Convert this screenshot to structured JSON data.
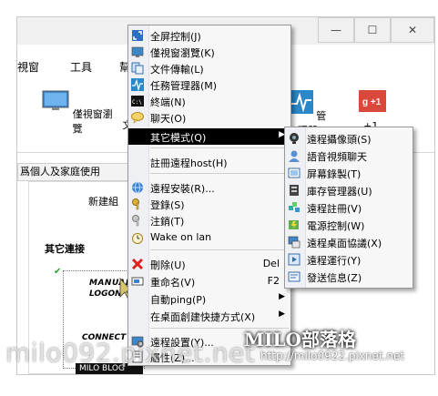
{
  "app": {
    "menu": [
      "視窗",
      "工具",
      "幫"
    ],
    "toolbar": [
      {
        "label": "僅視窗瀏覽",
        "icon": "monitor-icon"
      },
      {
        "label": "文",
        "icon": "none"
      },
      {
        "label": "管理器",
        "icon": "task-manager-icon"
      },
      {
        "label": "+1.",
        "icon": "plus-one-icon"
      }
    ],
    "tab_label": "爲個人及家庭使用",
    "new_group": "新建組",
    "other_connections": "其它連接",
    "thumbnail": {
      "line1": "MANUAL",
      "line2": "LOGON",
      "line3": "CONNECT",
      "caption": "MILO BLOG"
    }
  },
  "context_menu": {
    "items": [
      {
        "label": "全屏控制(J)",
        "icon": "fullscreen-icon"
      },
      {
        "label": "僅視窗瀏覽(K)",
        "icon": "window-view-icon"
      },
      {
        "label": "文件傳輸(L)",
        "icon": "file-transfer-icon"
      },
      {
        "label": "任務管理器(M)",
        "icon": "task-manager-icon"
      },
      {
        "label": "終端(N)",
        "icon": "terminal-icon"
      },
      {
        "label": "聊天(O)",
        "icon": "chat-icon"
      },
      {
        "label": "其它模式(Q)",
        "icon": "none",
        "submenu": true,
        "highlighted": true
      },
      {
        "label": "註冊遠程host(H)",
        "icon": "none"
      },
      {
        "label": "遠程安裝(R)...",
        "icon": "remote-install-icon"
      },
      {
        "label": "登錄(S)",
        "icon": "login-key-icon"
      },
      {
        "label": "注銷(T)",
        "icon": "logout-key-icon"
      },
      {
        "label": "Wake on lan",
        "icon": "alarm-clock-icon"
      },
      {
        "label": "刪除(U)",
        "icon": "delete-icon",
        "shortcut": "Del"
      },
      {
        "label": "重命名(V)",
        "icon": "rename-icon",
        "shortcut": "F2"
      },
      {
        "label": "自動ping(P)",
        "icon": "none",
        "submenu": true
      },
      {
        "label": "在桌面創建快捷方式(X)",
        "icon": "none",
        "submenu": true
      },
      {
        "label": "遠程設置(Y)...",
        "icon": "remote-settings-icon"
      },
      {
        "label": "屬性(Z)...",
        "icon": "properties-icon"
      }
    ]
  },
  "submenu": {
    "items": [
      {
        "label": "遠程攝像頭(S)",
        "icon": "webcam-icon"
      },
      {
        "label": "語音視頻聊天",
        "icon": "voice-chat-icon"
      },
      {
        "label": "屏幕錄製(T)",
        "icon": "screen-record-icon"
      },
      {
        "label": "庫存管理器(U)",
        "icon": "inventory-icon"
      },
      {
        "label": "遠程註冊(V)",
        "icon": "registry-icon"
      },
      {
        "label": "電源控制(W)",
        "icon": "power-icon"
      },
      {
        "label": "遠程桌面協議(X)",
        "icon": "rdp-icon"
      },
      {
        "label": "遠程運行(Y)",
        "icon": "remote-run-icon"
      },
      {
        "label": "發送信息(Z)",
        "icon": "send-message-icon"
      }
    ]
  },
  "watermark": {
    "title": "MILO部落格",
    "url_big": "milo092.pixnet.net",
    "url_small": "http://milo0922.pixnet.net"
  },
  "colors": {
    "menu_bg": "#f7f7f7",
    "highlight_bg": "#000000",
    "highlight_fg": "#ffffff"
  }
}
